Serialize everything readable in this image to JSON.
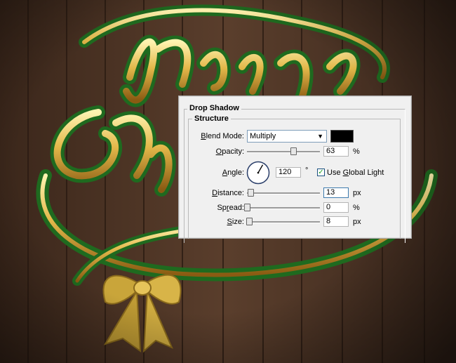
{
  "dialog": {
    "section_title": "Drop Shadow",
    "group_title": "Structure",
    "blend_mode": {
      "label_prefix": "B",
      "label_rest": "lend Mode:",
      "value": "Multiply",
      "color": "#000000"
    },
    "opacity": {
      "label_prefix": "O",
      "label_rest": "pacity:",
      "value": "63",
      "unit": "%",
      "level": 63
    },
    "angle": {
      "label_prefix": "A",
      "label_rest": "ngle:",
      "value": "120",
      "unit": "°",
      "degrees": 120,
      "global_light_prefix": "Use ",
      "global_light_underlined": "G",
      "global_light_rest": "lobal Light",
      "global_light_checked": true
    },
    "distance": {
      "label_prefix": "D",
      "label_rest": "istance:",
      "value": "13",
      "unit": "px",
      "level": 13
    },
    "spread": {
      "label_prefix": "Sp",
      "label_underlined": "r",
      "label_rest": "ead:",
      "value": "0",
      "unit": "%",
      "level": 0
    },
    "size": {
      "label_prefix": "S",
      "label_rest": "ize:",
      "value": "8",
      "unit": "px",
      "level": 8
    }
  }
}
